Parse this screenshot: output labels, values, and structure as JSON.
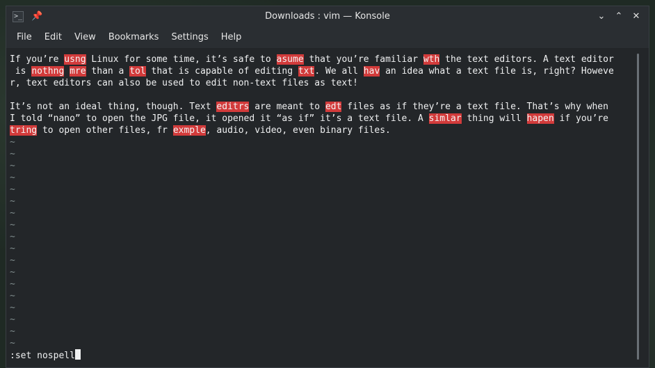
{
  "window": {
    "title": "Downloads : vim — Konsole",
    "app_icon": "terminal-icon",
    "pin_icon": "pin-icon",
    "controls": {
      "minimize": "⌄",
      "maximize": "⌃",
      "close": "✕"
    }
  },
  "menubar": {
    "items": [
      "File",
      "Edit",
      "View",
      "Bookmarks",
      "Settings",
      "Help"
    ]
  },
  "editor": {
    "lines": [
      [
        [
          "If you’re ",
          false
        ],
        [
          "usng",
          true
        ],
        [
          " Linux for some time, it’s safe to ",
          false
        ],
        [
          "asume",
          true
        ],
        [
          " that you’re familiar ",
          false
        ],
        [
          "wth",
          true
        ],
        [
          " the text editors. A text editor",
          false
        ]
      ],
      [
        [
          " is ",
          false
        ],
        [
          "nothng",
          true
        ],
        [
          " ",
          false
        ],
        [
          "mre",
          true
        ],
        [
          " than a ",
          false
        ],
        [
          "tol",
          true
        ],
        [
          " that is capable of editing ",
          false
        ],
        [
          "txt",
          true
        ],
        [
          ". We all ",
          false
        ],
        [
          "hav",
          true
        ],
        [
          " an idea what a text file is, right? Howeve",
          false
        ]
      ],
      [
        [
          "r, text editors can also be used to edit non-text files as text!",
          false
        ]
      ],
      [
        [
          "",
          false
        ]
      ],
      [
        [
          "It’s not an ideal thing, though. Text ",
          false
        ],
        [
          "editrs",
          true
        ],
        [
          " are meant to ",
          false
        ],
        [
          "edt",
          true
        ],
        [
          " files as if they’re a text file. That’s why when",
          false
        ]
      ],
      [
        [
          "I told “nano” to open the JPG file, it opened it “as if” it’s a text file. A ",
          false
        ],
        [
          "simlar",
          true
        ],
        [
          " thing will ",
          false
        ],
        [
          "hapen",
          true
        ],
        [
          " if you’re",
          false
        ]
      ],
      [
        [
          "tring",
          true
        ],
        [
          " to open other files, ",
          false
        ],
        [
          "fr",
          false
        ],
        [
          " ",
          false
        ],
        [
          "exmple",
          true
        ],
        [
          ", audio, video, even binary files.",
          false
        ]
      ]
    ],
    "empty_line_marker": "~",
    "empty_line_count": 18,
    "command": ":set nospell"
  },
  "colors": {
    "spell_error_bg": "#d23b3b",
    "background": "#232629",
    "foreground": "#eff0f1"
  }
}
